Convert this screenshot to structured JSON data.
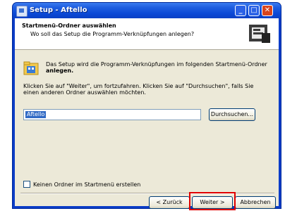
{
  "window": {
    "title": "Setup - Aftello"
  },
  "header": {
    "title": "Startmenü-Ordner auswählen",
    "subtitle": "Wo soll das Setup die Programm-Verknüpfungen anlegen?"
  },
  "body": {
    "info_line1": "Das Setup wird die Programm-Verknüpfungen im folgenden Startmenü-Ordner",
    "info_line2": "anlegen.",
    "para_line1": "Klicken Sie auf \"Weiter\", um fortzufahren. Klicken Sie auf \"Durchsuchen\", falls Sie",
    "para_line2": "einen anderen Ordner auswählen möchten."
  },
  "path_input": {
    "value": "Aftello"
  },
  "buttons": {
    "browse": "Durchsuchen...",
    "back": "< Zurück",
    "next": "Weiter >",
    "cancel": "Abbrechen"
  },
  "checkbox": {
    "label": "Keinen Ordner im Startmenü erstellen",
    "checked": false
  },
  "highlight": {
    "color": "#e00000",
    "target": "next-button"
  }
}
